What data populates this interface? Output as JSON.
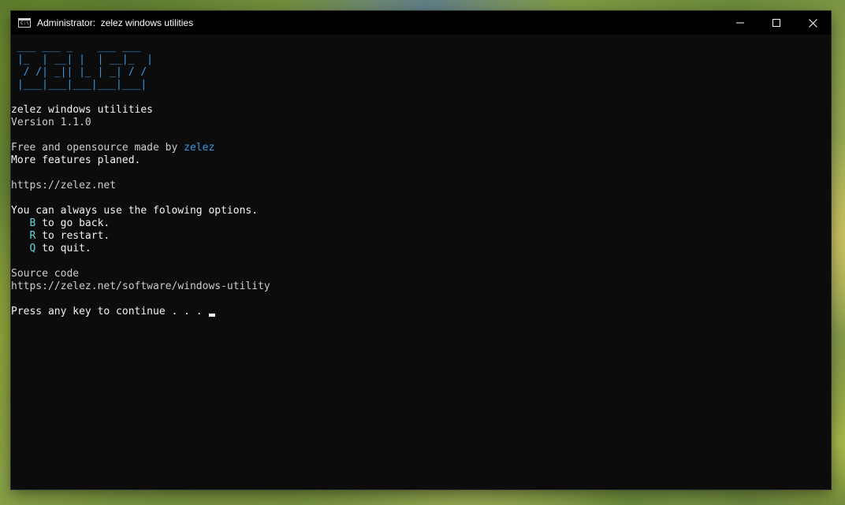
{
  "window": {
    "title": "Administrator:  zelez windows utilities",
    "app_icon_glyph": "C:\\.",
    "controls": [
      "minimize-icon",
      "maximize-icon",
      "close-icon"
    ]
  },
  "console": {
    "ascii_logo": [
      " ___ ___ _    ___ ___ ",
      " |_  | __| |  | __|_  |",
      "  / /| _|| |_ | _| / / ",
      " |___|___|___|___|___|"
    ],
    "title": "zelez windows utilities",
    "version": "Version 1.1.0",
    "credit_prefix": "Free and opensource made by ",
    "credit_author": "zelez",
    "features": "More features planed.",
    "website": "https://zelez.net",
    "options_intro": "You can always use the folowing options.",
    "options": [
      {
        "key": "B",
        "text": " to go back."
      },
      {
        "key": "R",
        "text": " to restart."
      },
      {
        "key": "Q",
        "text": " to quit."
      }
    ],
    "source_label": "Source code",
    "source_url": "https://zelez.net/software/windows-utility",
    "prompt": "Press any key to continue . . . "
  },
  "colors": {
    "console_bg": "#0c0c0c",
    "text": "#cccccc",
    "accent_blue": "#3a96dd",
    "accent_cyan": "#61d6d6"
  }
}
